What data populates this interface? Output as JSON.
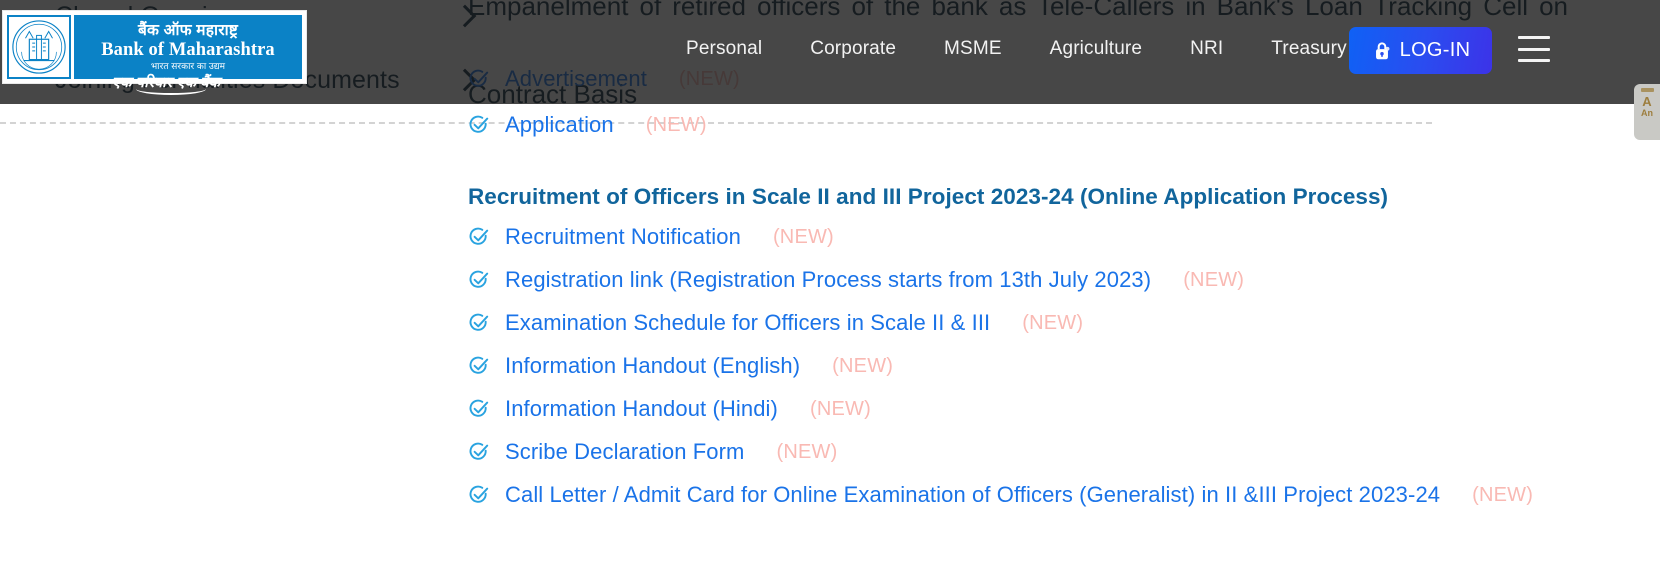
{
  "header": {
    "logo": {
      "name": "bank-of-maharashtra-logo",
      "hindi_name": "बैंक ऑफ महाराष्ट्र",
      "english_name": "Bank of Maharashtra",
      "subtitle": "भारत सरकार का उद्यम",
      "tagline": "एक परिवार एक बैंक"
    },
    "nav_items": [
      {
        "label": "Personal"
      },
      {
        "label": "Corporate"
      },
      {
        "label": "MSME"
      },
      {
        "label": "Agriculture"
      },
      {
        "label": "NRI"
      },
      {
        "label": "Treasury"
      }
    ],
    "login": {
      "label": "LOG-IN",
      "icon": "lock-icon"
    },
    "menu": {
      "icon": "hamburger-menu-icon"
    },
    "overlay_color": "#191919",
    "accent_color": "#0b82c6",
    "login_gradient_start": "#0f61f5",
    "login_gradient_end": "#3c33e8"
  },
  "side_widget": {
    "line1": "A",
    "line2": "An"
  },
  "background": {
    "accordion": [
      {
        "label": "Closed Openings",
        "icon": "chevron-right-icon"
      },
      {
        "label": "Joining Formalities Documents",
        "icon": "chevron-right-icon"
      }
    ],
    "heading_line1": "Empanelment of retired officers of the bank as Tele-Callers in Bank's Loan Tracking Cell on",
    "heading_line2": "Contract Basis",
    "obscured_link": {
      "label": "Advertisement",
      "badge": "(NEW)"
    }
  },
  "main": {
    "top_link": {
      "label": "Application",
      "badge": "(NEW)"
    },
    "section_title": "Recruitment of Officers in Scale II and III Project 2023-24 (Online Application Process)",
    "links": [
      {
        "label": "Recruitment Notification",
        "badge": "(NEW)"
      },
      {
        "label": "Registration link (Registration Process starts from 13th July 2023)",
        "badge": "(NEW)"
      },
      {
        "label": "Examination Schedule for Officers in Scale II & III",
        "badge": "(NEW)"
      },
      {
        "label": "Information Handout (English)",
        "badge": "(NEW)"
      },
      {
        "label": "Information Handout (Hindi)",
        "badge": "(NEW)"
      },
      {
        "label": "Scribe Declaration Form",
        "badge": "(NEW)"
      },
      {
        "label": "Call Letter / Admit Card for Online Examination of Officers (Generalist) in II &III Project 2023-24",
        "badge": "(NEW)"
      }
    ],
    "link_color": "#1a73e8",
    "badge_color": "#f9b9b3",
    "title_color": "#11659c"
  }
}
